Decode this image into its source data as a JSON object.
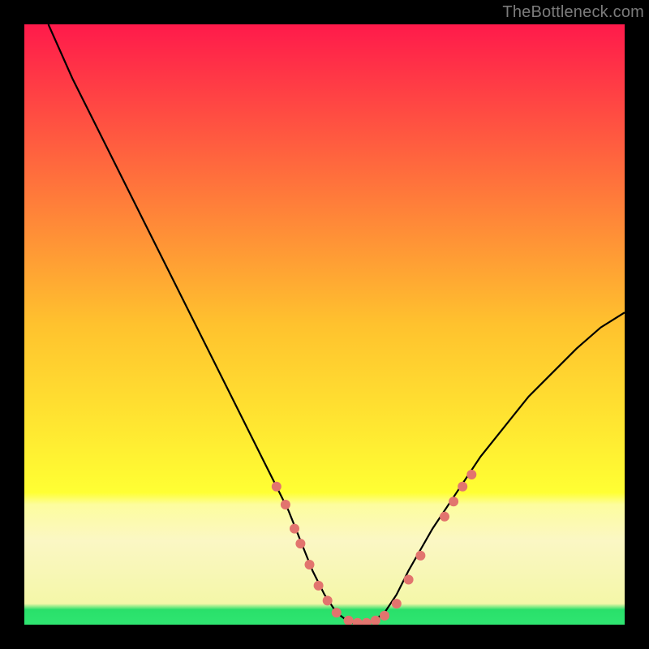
{
  "watermark": {
    "text": "TheBottleneck.com"
  },
  "chart_data": {
    "type": "line",
    "title": "",
    "xlabel": "",
    "ylabel": "",
    "xlim": [
      0,
      100
    ],
    "ylim": [
      0,
      100
    ],
    "grid": false,
    "legend": null,
    "background_gradient": {
      "stops": [
        {
          "offset": 0.0,
          "color": "#ff1a4b"
        },
        {
          "offset": 0.5,
          "color": "#ffc22e"
        },
        {
          "offset": 0.78,
          "color": "#ffff33"
        },
        {
          "offset": 0.8,
          "color": "#fdfd9e"
        },
        {
          "offset": 0.86,
          "color": "#fbf7c4"
        },
        {
          "offset": 0.965,
          "color": "#f4f7a8"
        },
        {
          "offset": 0.975,
          "color": "#29e06a"
        },
        {
          "offset": 1.0,
          "color": "#2fe571"
        }
      ]
    },
    "series": [
      {
        "name": "bottleneck-curve",
        "x": [
          4,
          8,
          12,
          16,
          20,
          24,
          28,
          32,
          36,
          40,
          42,
          44,
          46,
          48,
          50,
          52,
          54,
          56,
          58,
          60,
          62,
          64,
          68,
          72,
          76,
          80,
          84,
          88,
          92,
          96,
          100
        ],
        "y": [
          100,
          91,
          83,
          75,
          67,
          59,
          51,
          43,
          35,
          27,
          23,
          19,
          14,
          9,
          5,
          2,
          0.5,
          0,
          0.5,
          2,
          5,
          9,
          16,
          22,
          28,
          33,
          38,
          42,
          46,
          49.5,
          52
        ],
        "color": "#000000",
        "stroke_width": 2.2
      }
    ],
    "markers": {
      "color": "#e2746e",
      "points": [
        {
          "x": 42,
          "y": 23,
          "r": 6
        },
        {
          "x": 43.5,
          "y": 20,
          "r": 6
        },
        {
          "x": 45,
          "y": 16,
          "r": 6
        },
        {
          "x": 46,
          "y": 13.5,
          "r": 6
        },
        {
          "x": 47.5,
          "y": 10,
          "r": 6
        },
        {
          "x": 49,
          "y": 6.5,
          "r": 6
        },
        {
          "x": 50.5,
          "y": 4,
          "r": 6
        },
        {
          "x": 52,
          "y": 2,
          "r": 6
        },
        {
          "x": 54,
          "y": 0.7,
          "r": 6
        },
        {
          "x": 55.5,
          "y": 0.3,
          "r": 6
        },
        {
          "x": 57,
          "y": 0.3,
          "r": 6
        },
        {
          "x": 58.5,
          "y": 0.7,
          "r": 6
        },
        {
          "x": 60,
          "y": 1.5,
          "r": 6
        },
        {
          "x": 62,
          "y": 3.5,
          "r": 6
        },
        {
          "x": 64,
          "y": 7.5,
          "r": 6
        },
        {
          "x": 66,
          "y": 11.5,
          "r": 6
        },
        {
          "x": 70,
          "y": 18,
          "r": 6
        },
        {
          "x": 71.5,
          "y": 20.5,
          "r": 6
        },
        {
          "x": 73,
          "y": 23,
          "r": 6
        },
        {
          "x": 74.5,
          "y": 25,
          "r": 6
        }
      ]
    }
  }
}
